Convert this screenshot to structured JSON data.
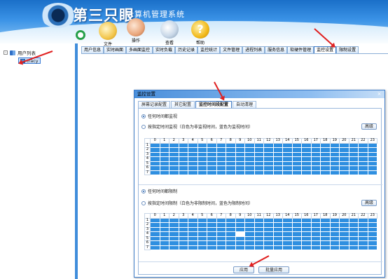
{
  "app": {
    "brand": "第三只眼",
    "subtitle": "计算机管理系统"
  },
  "toolbar": {
    "items": [
      {
        "label": "文件",
        "icon": "folder-icon"
      },
      {
        "label": "操作",
        "icon": "operation-icon"
      },
      {
        "label": "查看",
        "icon": "magnifier-icon"
      },
      {
        "label": "帮助",
        "icon": "help-icon"
      }
    ]
  },
  "tree": {
    "root_label": "用户列表",
    "child_label": "tracy",
    "expander": "-"
  },
  "tabs": [
    "用户信息",
    "实时画面",
    "多画面监控",
    "实时负载",
    "历史记录",
    "监控统计",
    "文件管理",
    "进程列表",
    "服务信息",
    "软硬件管理",
    "监控设置",
    "限制设置"
  ],
  "active_tab_index": 10,
  "dialog": {
    "title": "监控设置",
    "close_glyph": "×",
    "tabs": [
      "屏幕记录配置",
      "其它配置",
      "监控时间段配置",
      "自动清理"
    ],
    "active_tab_index": 2,
    "monitor": {
      "option_all": "任何时间都监视",
      "option_schedule": "按指定时间监视（白色为非监视时间，蓝色为监视时间）",
      "selected": "all",
      "advanced_label": "高级"
    },
    "limit": {
      "option_all": "任何时间都限制",
      "option_schedule": "按指定时间限制（白色为非限制时间，蓝色为限制时间）",
      "selected": "all",
      "advanced_label": "高级"
    },
    "grid_hours": [
      "0",
      "1",
      "2",
      "3",
      "4",
      "5",
      "6",
      "7",
      "8",
      "9",
      "10",
      "11",
      "12",
      "13",
      "14",
      "15",
      "16",
      "17",
      "18",
      "19",
      "20",
      "21",
      "22",
      "23"
    ],
    "grid_days": [
      "1",
      "2",
      "3",
      "4",
      "5",
      "6",
      "7"
    ],
    "limit_off_cells": [
      [
        4,
        9
      ]
    ],
    "apply_label": "应用",
    "batch_apply_label": "批量应用"
  },
  "colors": {
    "accent": "#3f8ddb",
    "grid_on": "#2f8fe0",
    "annotation": "#e02020"
  }
}
